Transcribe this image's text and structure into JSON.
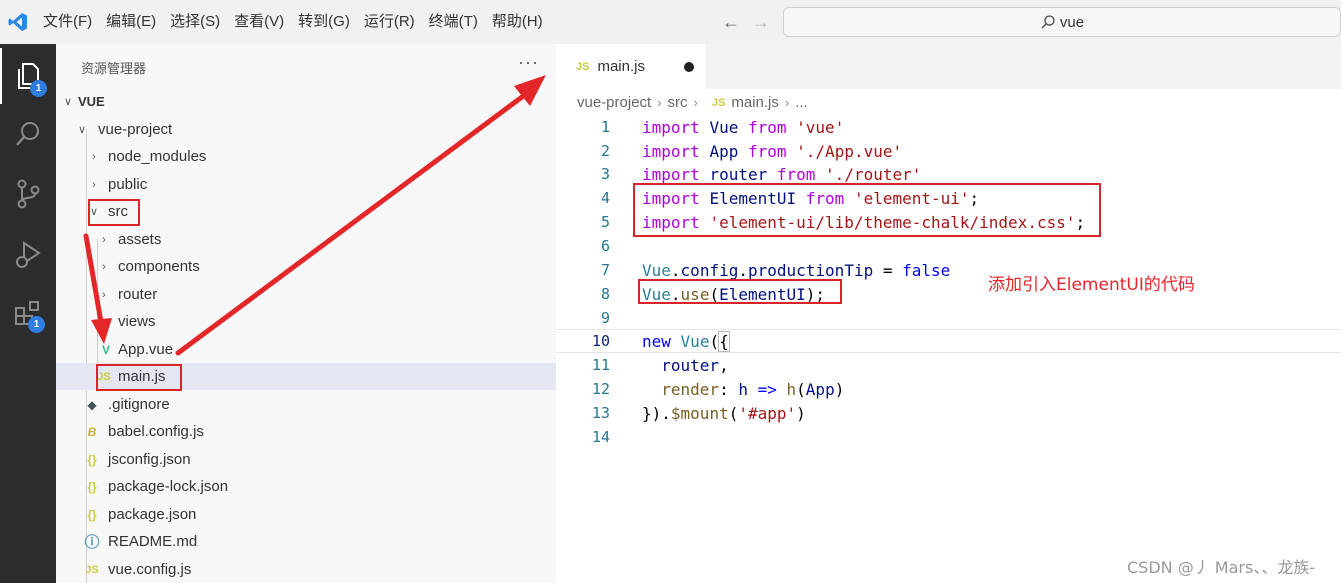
{
  "menu": {
    "items": [
      "文件(F)",
      "编辑(E)",
      "选择(S)",
      "查看(V)",
      "转到(G)",
      "运行(R)",
      "终端(T)",
      "帮助(H)"
    ]
  },
  "command_center": {
    "text": "vue",
    "icon": "search-icon"
  },
  "activity_bar": {
    "explorer_badge": "1",
    "extensions_badge": "1"
  },
  "sidebar": {
    "title": "资源管理器",
    "more": "···",
    "root": "VUE",
    "tree": [
      {
        "label": "vue-project",
        "kind": "folder-open"
      },
      {
        "label": "node_modules",
        "kind": "folder"
      },
      {
        "label": "public",
        "kind": "folder"
      },
      {
        "label": "src",
        "kind": "folder-open"
      },
      {
        "label": "assets",
        "kind": "folder"
      },
      {
        "label": "components",
        "kind": "folder"
      },
      {
        "label": "router",
        "kind": "folder"
      },
      {
        "label": "views",
        "kind": "folder"
      },
      {
        "label": "App.vue",
        "kind": "vue-file"
      },
      {
        "label": "main.js",
        "kind": "js-file"
      },
      {
        "label": ".gitignore",
        "kind": "git-file"
      },
      {
        "label": "babel.config.js",
        "kind": "babel-file"
      },
      {
        "label": "jsconfig.json",
        "kind": "json-file"
      },
      {
        "label": "package-lock.json",
        "kind": "json-file"
      },
      {
        "label": "package.json",
        "kind": "json-file"
      },
      {
        "label": "README.md",
        "kind": "info-file"
      },
      {
        "label": "vue.config.js",
        "kind": "js-file"
      }
    ]
  },
  "editor": {
    "tab_label": "main.js",
    "tab_icon": "JS",
    "breadcrumb": [
      "vue-project",
      "src",
      "main.js",
      "..."
    ],
    "line_numbers": [
      "1",
      "2",
      "3",
      "4",
      "5",
      "6",
      "7",
      "8",
      "9",
      "10",
      "11",
      "12",
      "13",
      "14"
    ],
    "annotation": "添加引入ElementUI的代码"
  },
  "watermark": "CSDN @丿 Mars、、龙族-",
  "colors": {
    "highlight_box": "#d9252a",
    "keyword": "#0000ff",
    "string": "#a31515",
    "accent_badge": "#2f7de1"
  }
}
